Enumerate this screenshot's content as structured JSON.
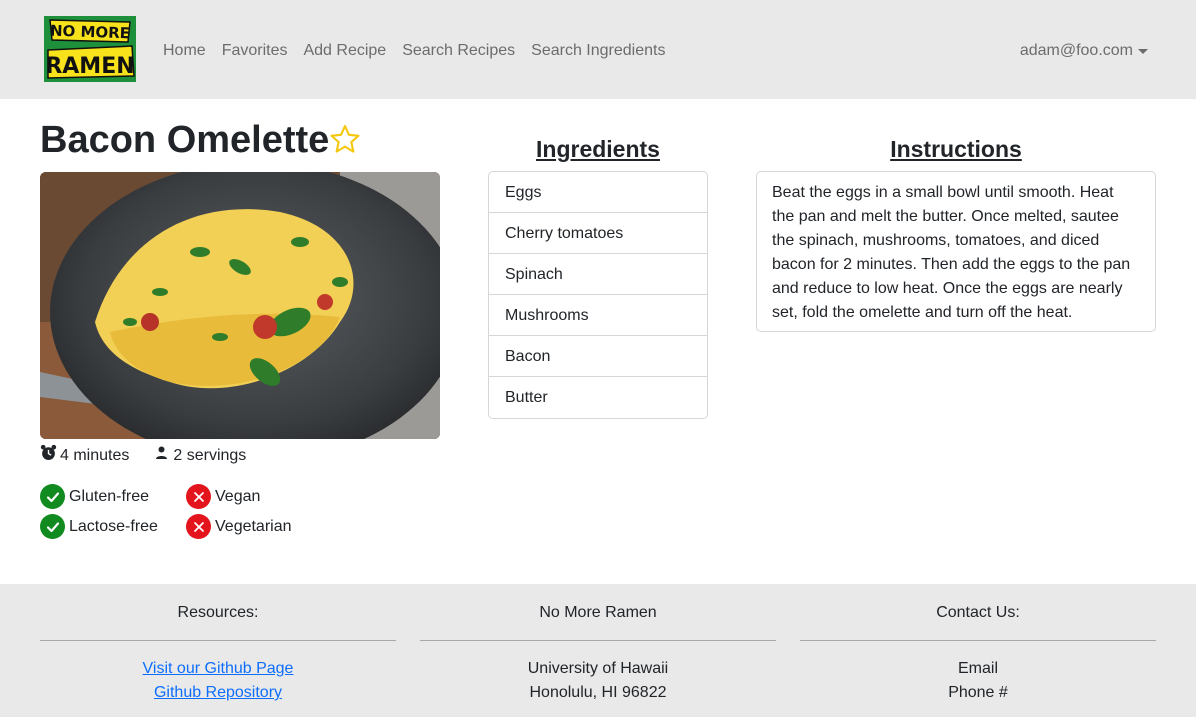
{
  "nav": {
    "logo_text": "NO MORE RAMEN",
    "links": [
      "Home",
      "Favorites",
      "Add Recipe",
      "Search Recipes",
      "Search Ingredients"
    ],
    "user": "adam@foo.com"
  },
  "recipe": {
    "title": "Bacon Omelette",
    "time": "4 minutes",
    "servings": "2 servings",
    "diet": [
      {
        "label": "Gluten-free",
        "ok": true
      },
      {
        "label": "Vegan",
        "ok": false
      },
      {
        "label": "Lactose-free",
        "ok": true
      },
      {
        "label": "Vegetarian",
        "ok": false
      }
    ]
  },
  "ingredients": {
    "heading": "Ingredients",
    "items": [
      "Eggs",
      "Cherry tomatoes",
      "Spinach",
      "Mushrooms",
      "Bacon",
      "Butter"
    ]
  },
  "instructions": {
    "heading": "Instructions",
    "text": "Beat the eggs in a small bowl until smooth. Heat the pan and melt the butter. Once melted, sautee the spinach, mushrooms, tomatoes, and diced bacon for 2 minutes. Then add the eggs to the pan and reduce to low heat. Once the eggs are nearly set, fold the omelette and turn off the heat."
  },
  "footer": {
    "resources": {
      "heading": "Resources:",
      "link1": "Visit our Github Page",
      "link2": "Github Repository"
    },
    "about": {
      "heading": "No More Ramen",
      "line1": "University of Hawaii",
      "line2": "Honolulu, HI 96822"
    },
    "contact": {
      "heading": "Contact Us:",
      "line1": "Email",
      "line2": "Phone #"
    }
  },
  "colors": {
    "navbar_bg": "#e9e9e9",
    "link_blue": "#0d6efd",
    "check_green": "#118a1f",
    "cross_red": "#e3141b",
    "star_gold": "#f4c70a",
    "logo_yellow": "#f7e21b",
    "logo_green": "#1e8f3b"
  }
}
